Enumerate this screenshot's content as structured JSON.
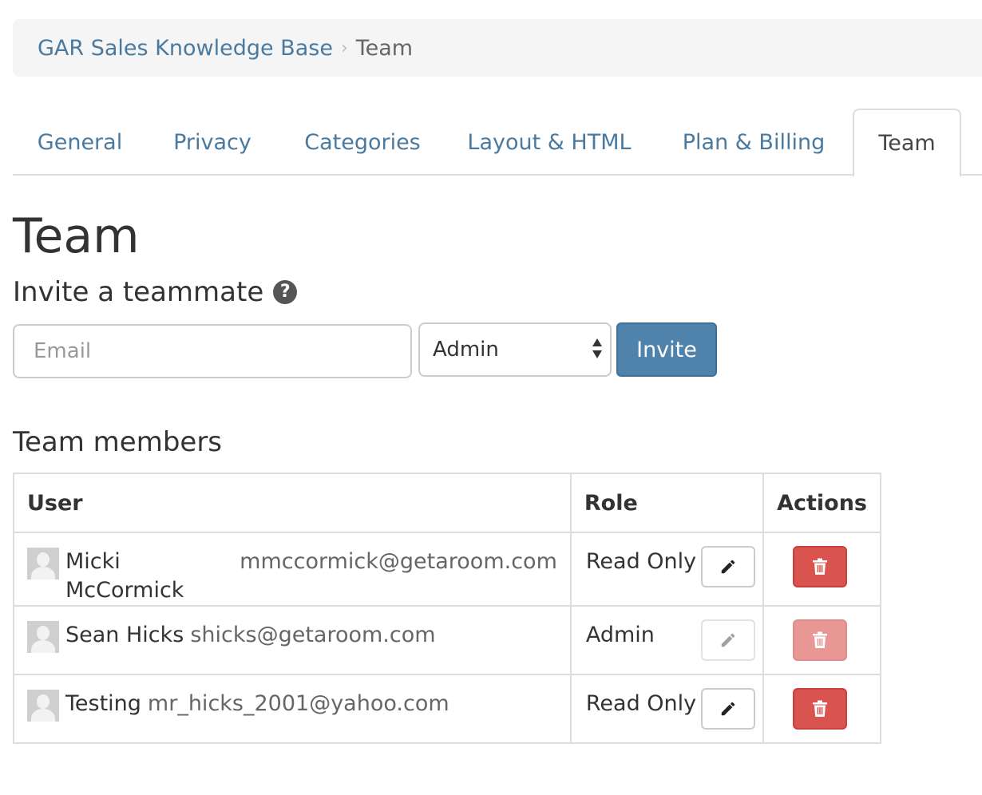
{
  "breadcrumb": {
    "parent": "GAR Sales Knowledge Base",
    "separator": "›",
    "current": "Team"
  },
  "tabs": [
    {
      "label": "General"
    },
    {
      "label": "Privacy"
    },
    {
      "label": "Categories"
    },
    {
      "label": "Layout & HTML"
    },
    {
      "label": "Plan & Billing"
    },
    {
      "label": "Team",
      "active": true
    }
  ],
  "page": {
    "title": "Team",
    "invite_heading": "Invite a teammate",
    "help_icon": "?"
  },
  "invite_form": {
    "email_placeholder": "Email",
    "email_value": "",
    "role_selected": "Admin",
    "invite_label": "Invite"
  },
  "members": {
    "heading": "Team members",
    "columns": {
      "user": "User",
      "role": "Role",
      "actions": "Actions"
    },
    "rows": [
      {
        "name": "Micki McCormick",
        "email": "mmccormick@getaroom.com",
        "role": "Read Only",
        "editable": true,
        "deletable": true
      },
      {
        "name": "Sean Hicks",
        "email": "shicks@getaroom.com",
        "role": "Admin",
        "editable": false,
        "deletable": false
      },
      {
        "name": "Testing",
        "email": "mr_hicks_2001@yahoo.com",
        "role": "Read Only",
        "editable": true,
        "deletable": true
      }
    ]
  },
  "colors": {
    "link": "#4a7a9f",
    "primary": "#4f83ab",
    "danger": "#d9534f"
  },
  "icons": {
    "edit": "pencil-icon",
    "delete": "trash-icon",
    "help": "question-circle-icon",
    "avatar": "user-avatar-icon"
  }
}
